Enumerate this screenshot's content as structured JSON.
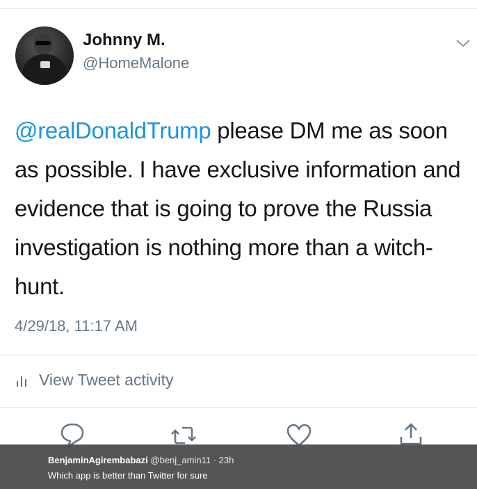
{
  "tweet": {
    "display_name": "Johnny M.",
    "handle": "@HomeMalone",
    "mention": "@realDonaldTrump",
    "text_after_mention": " please DM me as soon as possible. I have exclusive information and evidence that is going to prove the Russia investigation is nothing more than a witch-hunt.",
    "timestamp": "4/29/18, 11:17 AM",
    "activity_label": "View Tweet activity"
  },
  "icons": {
    "more": "chevron-down-icon",
    "activity": "bar-chart-icon",
    "reply": "reply-icon",
    "retweet": "retweet-icon",
    "like": "heart-icon",
    "share": "share-icon"
  },
  "colors": {
    "mention": "#1b95e0",
    "secondary_text": "#657786",
    "overlay": "#464646"
  },
  "comment": {
    "author": "BenjaminAgirembabazi",
    "handle": "@benj_amin11",
    "time": "· 23h",
    "text": "Which app is better than Twitter for sure"
  }
}
